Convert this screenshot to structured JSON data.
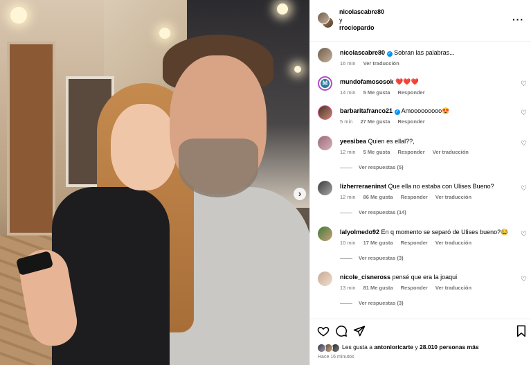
{
  "post": {
    "author": "nicolascabre80",
    "conjunction": "y",
    "coauthor": "rrociopardo",
    "more_icon": "more-horizontal-icon"
  },
  "caption": {
    "username": "nicolascabre80",
    "text": "Sobran las palabras...",
    "time": "16 min",
    "translate": "Ver traducción"
  },
  "comments": [
    {
      "username": "mundofamososok",
      "text": "❤️❤️❤️",
      "time": "14 min",
      "likes": "5 Me gusta",
      "reply": "Responder",
      "translate": "",
      "replies": ""
    },
    {
      "username": "barbaritafranco21",
      "text": "Amooooooooo😍",
      "time": "5 min",
      "likes": "27 Me gusta",
      "reply": "Responder",
      "translate": "",
      "replies": ""
    },
    {
      "username": "yeesibea",
      "text": "Quien es ellal??,",
      "time": "12 min",
      "likes": "5 Me gusta",
      "reply": "Responder",
      "translate": "Ver traducción",
      "replies": "Ver respuestas (5)"
    },
    {
      "username": "lizherreraeninst",
      "text": "Que ella no estaba con Ulises Bueno?",
      "time": "12 min",
      "likes": "86 Me gusta",
      "reply": "Responder",
      "translate": "Ver traducción",
      "replies": "Ver respuestas (14)"
    },
    {
      "username": "lalyolmedo92",
      "text": "En q momento se separó de Ulises bueno?😂",
      "time": "10 min",
      "likes": "17 Me gusta",
      "reply": "Responder",
      "translate": "Ver traducción",
      "replies": "Ver respuestas (3)"
    },
    {
      "username": "nicole_cisneross",
      "text": "pensé que era la joaqui",
      "time": "13 min",
      "likes": "81 Me gusta",
      "reply": "Responder",
      "translate": "Ver traducción",
      "replies": "Ver respuestas (3)"
    }
  ],
  "actions": {
    "like_icon": "heart-icon",
    "comment_icon": "comment-icon",
    "share_icon": "share-icon",
    "save_icon": "bookmark-icon"
  },
  "likes": {
    "prefix": "Les gusta a",
    "user": "antonioricarte",
    "mid": "y",
    "count": "28.010 personas más"
  },
  "timestamp": "Hace 16 minutos",
  "colors": {
    "verified": "#0095f6",
    "muted": "#737373",
    "border": "#efefef"
  }
}
